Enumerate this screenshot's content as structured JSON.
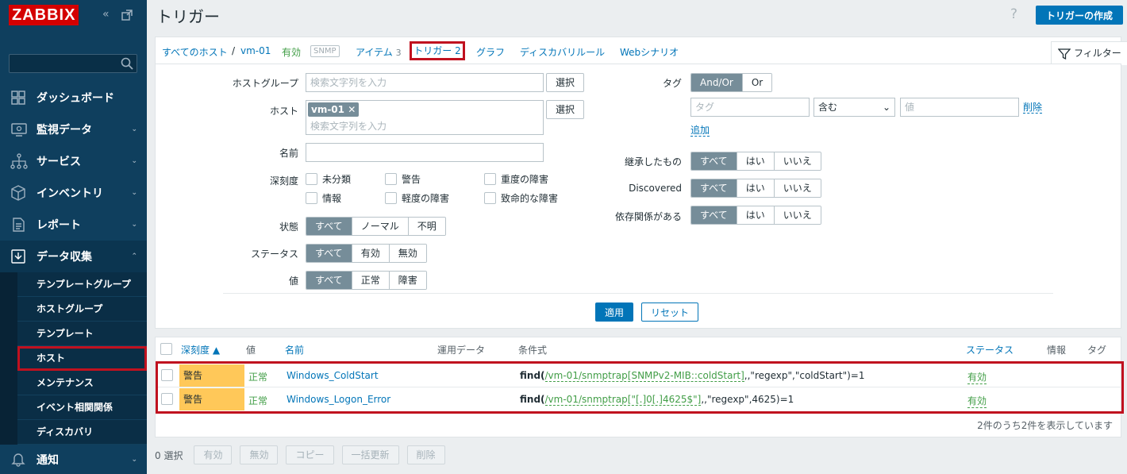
{
  "app": {
    "logo": "ZABBIX"
  },
  "sidebar": {
    "nav": [
      {
        "label": "ダッシュボード",
        "icon": "dashboard-icon"
      },
      {
        "label": "監視データ",
        "icon": "monitoring-icon"
      },
      {
        "label": "サービス",
        "icon": "services-icon"
      },
      {
        "label": "インベントリ",
        "icon": "inventory-icon"
      },
      {
        "label": "レポート",
        "icon": "reports-icon"
      },
      {
        "label": "データ収集",
        "icon": "data-collection-icon"
      }
    ],
    "sub": [
      "テンプレートグループ",
      "ホストグループ",
      "テンプレート",
      "ホスト",
      "メンテナンス",
      "イベント相関関係",
      "ディスカバリ"
    ],
    "notify": "通知"
  },
  "header": {
    "title": "トリガー",
    "help": "?",
    "create_button": "トリガーの作成"
  },
  "breadcrumb": {
    "all_hosts": "すべてのホスト",
    "sep": "/",
    "host": "vm-01",
    "enabled": "有効",
    "snmp": "SNMP",
    "items": "アイテム",
    "items_count": "3",
    "triggers": "トリガー",
    "triggers_count": "2",
    "graphs": "グラフ",
    "discovery": "ディスカバリルール",
    "web": "Webシナリオ"
  },
  "filter": {
    "tab": "フィルター",
    "host_group_label": "ホストグループ",
    "search_placeholder": "検索文字列を入力",
    "select": "選択",
    "host_label": "ホスト",
    "host_chip": "vm-01",
    "name_label": "名前",
    "severity_label": "深刻度",
    "severities": [
      "未分類",
      "警告",
      "重度の障害",
      "情報",
      "軽度の障害",
      "致命的な障害"
    ],
    "state_label": "状態",
    "state_opts": [
      "すべて",
      "ノーマル",
      "不明"
    ],
    "status_label": "ステータス",
    "status_opts": [
      "すべて",
      "有効",
      "無効"
    ],
    "value_label": "値",
    "value_opts": [
      "すべて",
      "正常",
      "障害"
    ],
    "tags_label": "タグ",
    "tag_ops": [
      "And/Or",
      "Or"
    ],
    "tag_placeholder": "タグ",
    "tag_operator": "含む",
    "value_placeholder": "値",
    "remove": "削除",
    "add": "追加",
    "inherited_label": "継承したもの",
    "discovered_label": "Discovered",
    "dependencies_label": "依存関係がある",
    "yn_opts": [
      "すべて",
      "はい",
      "いいえ"
    ],
    "apply": "適用",
    "reset": "リセット"
  },
  "table": {
    "headers": {
      "severity": "深刻度 ▲",
      "value": "値",
      "name": "名前",
      "operational": "運用データ",
      "expression": "条件式",
      "status": "ステータス",
      "info": "情報",
      "tags": "タグ"
    },
    "rows": [
      {
        "severity": "警告",
        "value": "正常",
        "name": "Windows_ColdStart",
        "expr_fn": "find(",
        "expr_item": "/vm-01/snmptrap[SNMPv2-MIB::coldStart]",
        "expr_rest": ",,\"regexp\",\"coldStart\")=1",
        "status": "有効"
      },
      {
        "severity": "警告",
        "value": "正常",
        "name": "Windows_Logon_Error",
        "expr_fn": "find(",
        "expr_item": "/vm-01/snmptrap[\"[.]0[.]4625$\"]",
        "expr_rest": ",,\"regexp\",4625)=1",
        "status": "有効"
      }
    ],
    "footer": "2件のうち2件を表示しています"
  },
  "actions": {
    "selected": "0 選択",
    "buttons": [
      "有効",
      "無効",
      "コピー",
      "一括更新",
      "削除"
    ]
  }
}
